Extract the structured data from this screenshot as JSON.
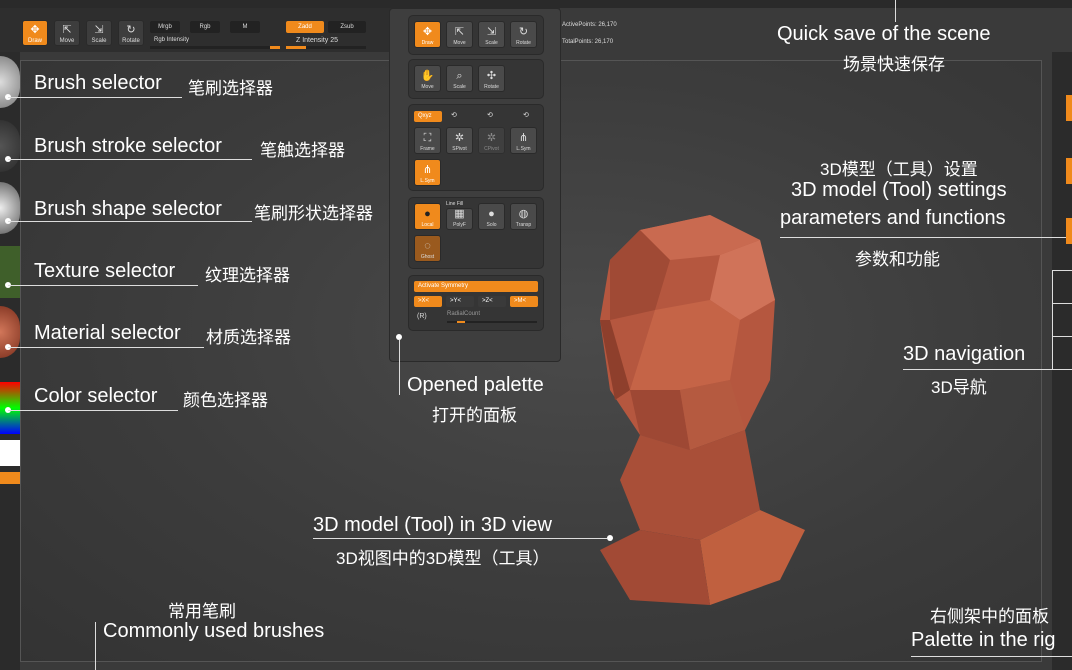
{
  "toolbar": {
    "draw_label": "Draw",
    "move_label": "Move",
    "scale_label": "Scale",
    "rotate_label": "Rotate",
    "mrgb_label": "Mrgb",
    "rgb_label": "Rgb",
    "m_label": "M",
    "rgb_intensity_label": "Rgb Intensity",
    "zadd_label": "Zadd",
    "zsub_label": "Zsub",
    "z_intensity_label": "Z Intensity 25",
    "active_points": "ActivePoints: 26,170",
    "total_points": "TotalPoints: 26,170"
  },
  "palette": {
    "draw_label": "Draw",
    "move_label": "Move",
    "scale_label": "Scale",
    "rotate_label": "Rotate",
    "move2_label": "Move",
    "scale2_label": "Scale",
    "rotate2_label": "Rotate",
    "xyz_label": "Qxyz",
    "frame_label": "Frame",
    "spivot_label": "SPivot",
    "cpivot_label": "CPivot",
    "lsym_label": "L.Sym",
    "lsym2_label": "L.Sym",
    "local_label": "Local",
    "linefill_label": "Line Fill",
    "polyf_label": "PolyF",
    "solo_label": "Solo",
    "transp_label": "Transp",
    "ghost_label": "Ghost",
    "activate_symmetry": "Activate Symmetry",
    "x_label": ">X<",
    "y_label": ">Y<",
    "z_label": ">Z<",
    "m_label": ">M<",
    "r_label": "(R)",
    "radial_count": "RadialCount"
  },
  "annotations": {
    "quick_save_en": "Quick save of the scene",
    "quick_save_zh": "场景快速保存",
    "brush_selector_en": "Brush selector",
    "brush_selector_zh": "笔刷选择器",
    "stroke_selector_en": "Brush stroke selector",
    "stroke_selector_zh": "笔触选择器",
    "shape_selector_en": "Brush shape selector",
    "shape_selector_zh": "笔刷形状选择器",
    "texture_selector_en": "Texture selector",
    "texture_selector_zh": "纹理选择器",
    "material_selector_en": "Material selector",
    "material_selector_zh": "材质选择器",
    "color_selector_en": "Color selector",
    "color_selector_zh": "颜色选择器",
    "opened_palette_en": "Opened palette",
    "opened_palette_zh": "打开的面板",
    "tool_settings_zh": "3D模型（工具）设置",
    "tool_settings_en1": "3D model (Tool) settings",
    "tool_settings_en2": "parameters and functions",
    "tool_settings_zh2": "参数和功能",
    "navigation_en": "3D navigation",
    "navigation_zh": "3D导航",
    "model_in_view_en": "3D model (Tool) in 3D view",
    "model_in_view_zh": "3D视图中的3D模型（工具）",
    "common_brushes_zh": "常用笔刷",
    "common_brushes_en": "Commonly used brushes",
    "right_palette_zh": "右侧架中的面板",
    "right_palette_en": "Palette in the rig"
  },
  "colors": {
    "accent": "#f08a1c",
    "model": "#b5573f"
  }
}
